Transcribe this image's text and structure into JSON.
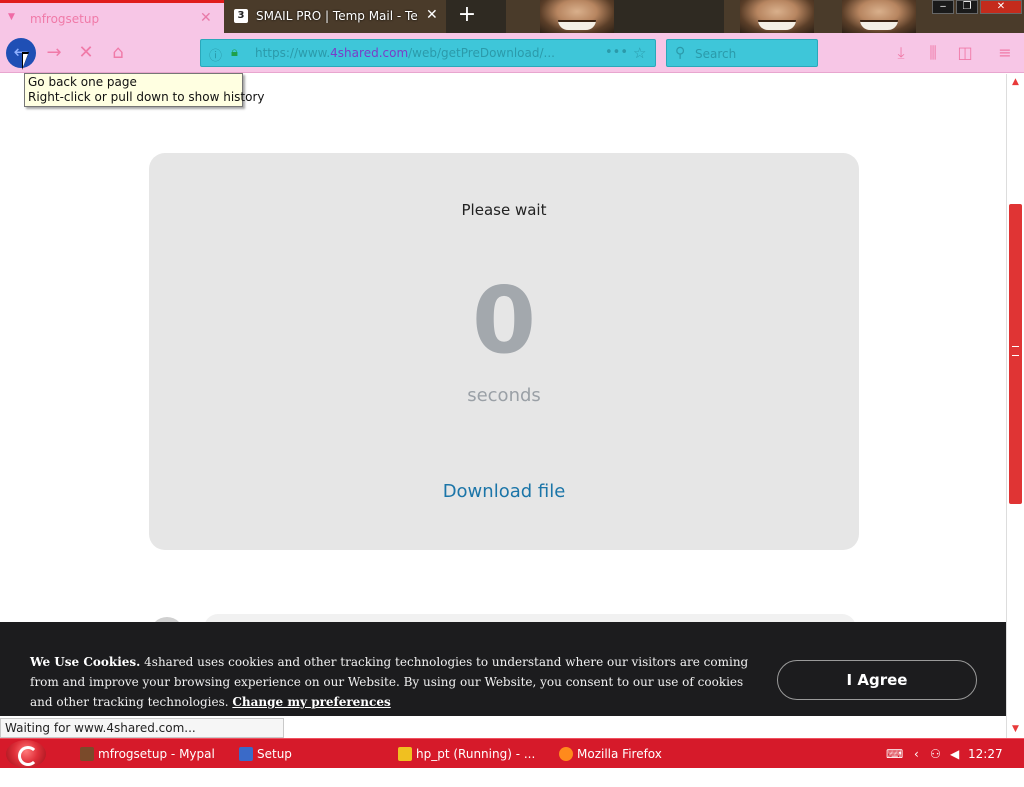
{
  "browser": {
    "tabs": [
      {
        "title": "mfrogsetup",
        "active": true
      },
      {
        "title": "SMAIL PRO | Temp Mail - Temp",
        "active": false,
        "favicon_text": "3"
      }
    ],
    "url": {
      "prefix": "https://www.",
      "host": "4shared.com",
      "path": "/web/getPreDownload/..."
    },
    "search_placeholder": "Search",
    "tooltip": {
      "line1": "Go back one page",
      "line2": "Right-click or pull down to show history"
    },
    "status_text": "Waiting for www.4shared.com..."
  },
  "page": {
    "wait_label": "Please wait",
    "countdown": "0",
    "seconds_label": "seconds",
    "download_link": "Download file"
  },
  "cookie_banner": {
    "heading": "We Use Cookies.",
    "body": " 4shared uses cookies and other tracking technologies to understand where our visitors are coming from and improve your browsing experience on our Website. By using our Website, you consent to our use of cookies and other tracking technologies. ",
    "link": "Change my preferences",
    "agree_button": "I Agree"
  },
  "taskbar": {
    "items": [
      {
        "label": "mfrogsetup - Mypal",
        "icon": "mypal-icon"
      },
      {
        "label": "Setup",
        "icon": "setup-icon"
      },
      {
        "label": "hp_pt (Running) - ...",
        "icon": "virtualbox-icon"
      },
      {
        "label": "Mozilla Firefox",
        "icon": "firefox-icon"
      }
    ],
    "clock": "12:27 AM"
  },
  "colors": {
    "toolbar_pink": "#f7c6e6",
    "urlbar_cyan": "#3ec6d9",
    "taskbar_red": "#d61a2a",
    "link_blue": "#1b75a8",
    "card_gray": "#e6e6e6",
    "banner_dark": "#1c1c1e"
  }
}
